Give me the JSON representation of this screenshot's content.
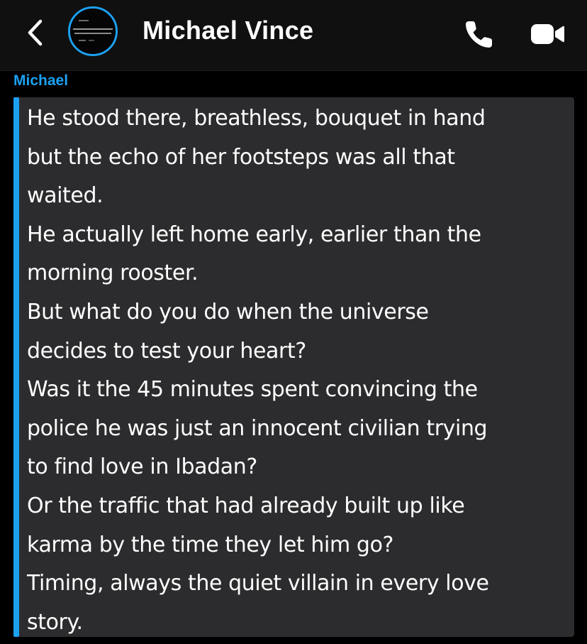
{
  "header": {
    "contact_name": "Michael Vince",
    "back_icon": "chevron-left-icon",
    "call_icon": "phone-icon",
    "video_icon": "video-camera-icon",
    "avatar_ring_color": "#1ca1f2"
  },
  "chat": {
    "sender_label": "Michael",
    "accent_color": "#1ca1f2",
    "message_lines": [
      "He stood there, breathless, bouquet in hand",
      "but the echo of her footsteps was all that",
      "waited.",
      "He actually left home early, earlier than the",
      "morning rooster.",
      "But what do you do when the universe",
      "decides to test your heart?",
      "Was it the 45 minutes spent convincing the",
      "police he was just an innocent civilian trying",
      "to find love in Ibadan?",
      "Or the traffic that had already built up like",
      "karma by the time they let him go?",
      "Timing, always the quiet villain in every love",
      "story."
    ]
  }
}
